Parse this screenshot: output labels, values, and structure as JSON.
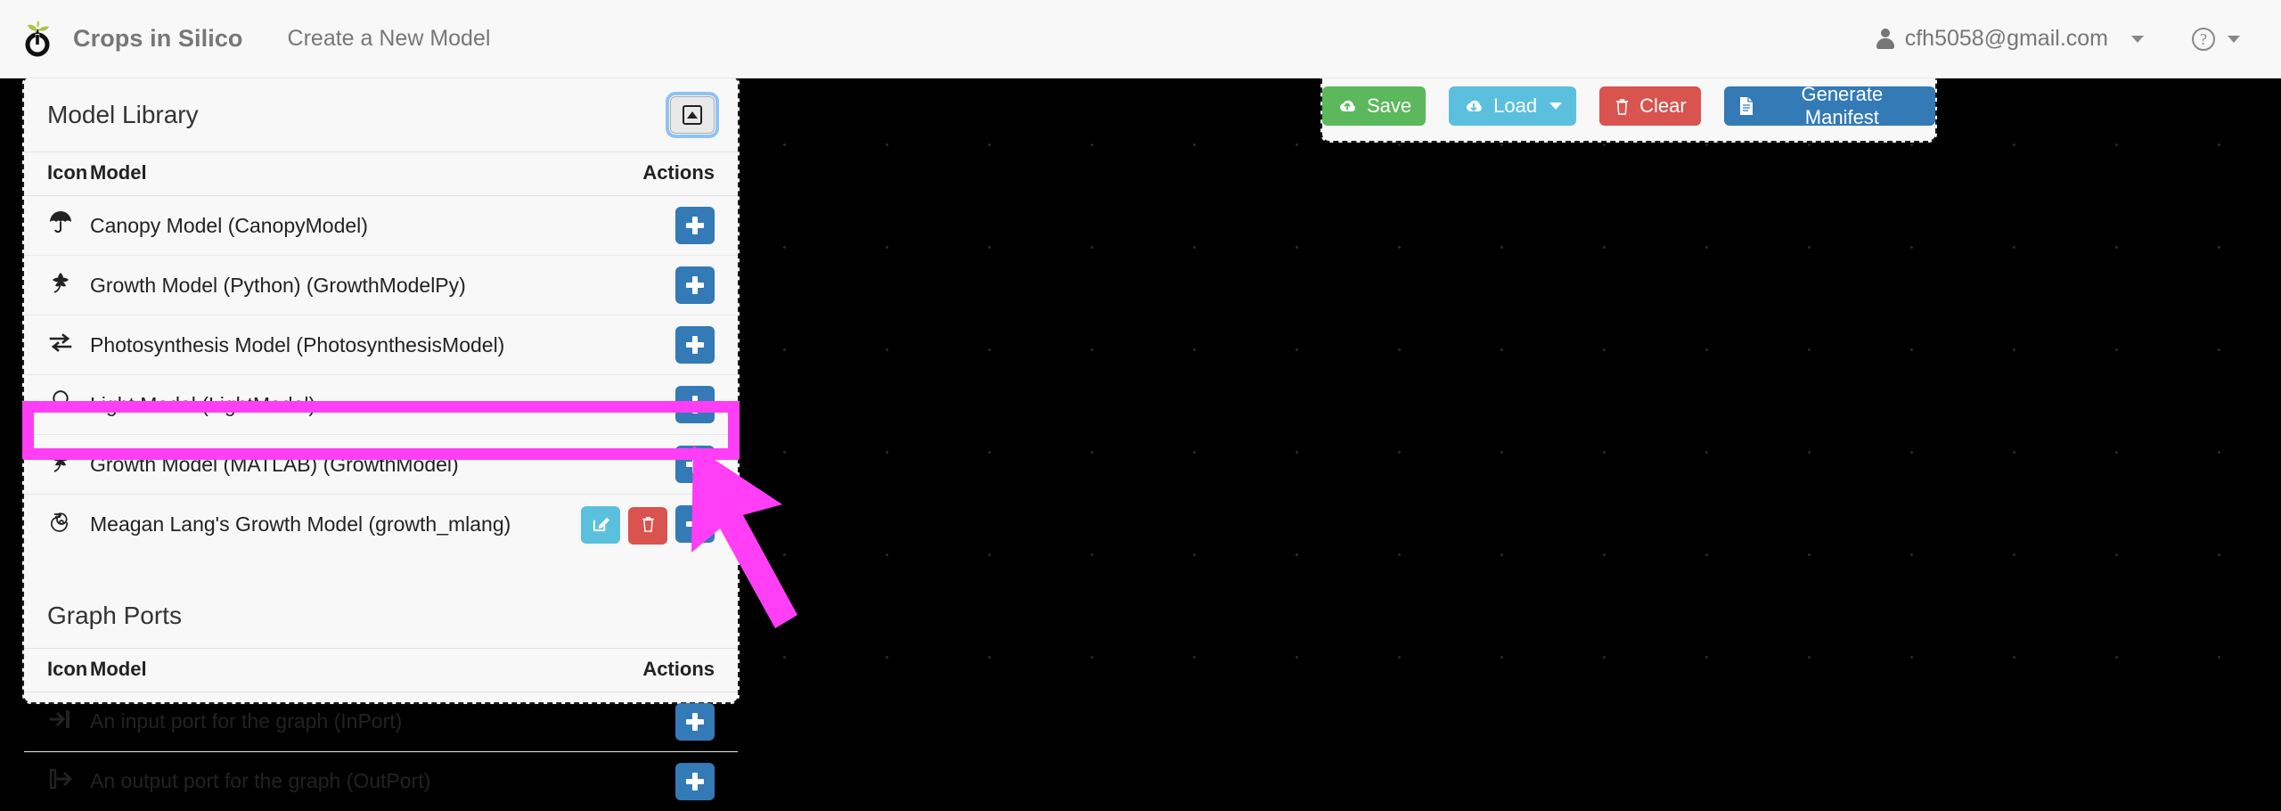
{
  "navbar": {
    "logo_icon": "sprout-power-logo",
    "brand": "Crops in Silico",
    "nav_link": "Create a New Model",
    "user_icon": "user-icon",
    "user_email": "cfh5058@gmail.com",
    "user_caret_icon": "chevron-down-icon",
    "help_icon": "question-circle-icon",
    "help_glyph": "?",
    "help_caret_icon": "chevron-down-icon"
  },
  "library_panel": {
    "title": "Model Library",
    "collapse_button_icon": "collapse-panel-icon",
    "columns": {
      "icon": "Icon",
      "model": "Model",
      "actions": "Actions"
    },
    "rows": [
      {
        "icon": "umbrella-icon",
        "label": "Canopy Model (CanopyModel)",
        "actions": [
          "add"
        ]
      },
      {
        "icon": "leaf-icon",
        "label": "Growth Model (Python) (GrowthModelPy)",
        "actions": [
          "add"
        ]
      },
      {
        "icon": "exchange-icon",
        "label": "Photosynthesis Model (PhotosynthesisModel)",
        "actions": [
          "add"
        ]
      },
      {
        "icon": "lightbulb-icon",
        "label": "Light Model (LightModel)",
        "actions": [
          "add"
        ]
      },
      {
        "icon": "leaf-icon",
        "label": "Growth Model (MATLAB) (GrowthModel)",
        "actions": [
          "add"
        ]
      },
      {
        "icon": "spiral-icon",
        "label": "Meagan Lang's Growth Model (growth_mlang)",
        "actions": [
          "edit",
          "delete",
          "add"
        ],
        "highlighted": true
      }
    ]
  },
  "ports_panel": {
    "title": "Graph Ports",
    "columns": {
      "icon": "Icon",
      "model": "Model",
      "actions": "Actions"
    },
    "rows": [
      {
        "icon": "sign-in-icon",
        "label": "An input port for the graph (InPort)",
        "actions": [
          "add"
        ]
      },
      {
        "icon": "sign-out-icon",
        "label": "An output port for the graph (OutPort)",
        "actions": [
          "add"
        ]
      }
    ]
  },
  "toolbar": {
    "save": {
      "label": "Save",
      "icon": "cloud-upload-icon",
      "color": "#5cb85c"
    },
    "load": {
      "label": "Load",
      "icon": "cloud-download-icon",
      "color": "#5bc0de",
      "caret_icon": "chevron-down-icon"
    },
    "clear": {
      "label": "Clear",
      "icon": "trash-icon",
      "color": "#d9534f"
    },
    "generate": {
      "label": "Generate Manifest",
      "icon": "file-text-icon",
      "color": "#337ab7"
    }
  },
  "annotation": {
    "highlight_color": "#FF3EF5",
    "target": "Meagan Lang's Growth Model (growth_mlang)"
  },
  "action_icons": {
    "add": "plus-icon",
    "edit": "pencil-square-icon",
    "delete": "trash-icon"
  },
  "canvas": {
    "background_color": "#000000",
    "dot_color": "#2a2a2a"
  }
}
